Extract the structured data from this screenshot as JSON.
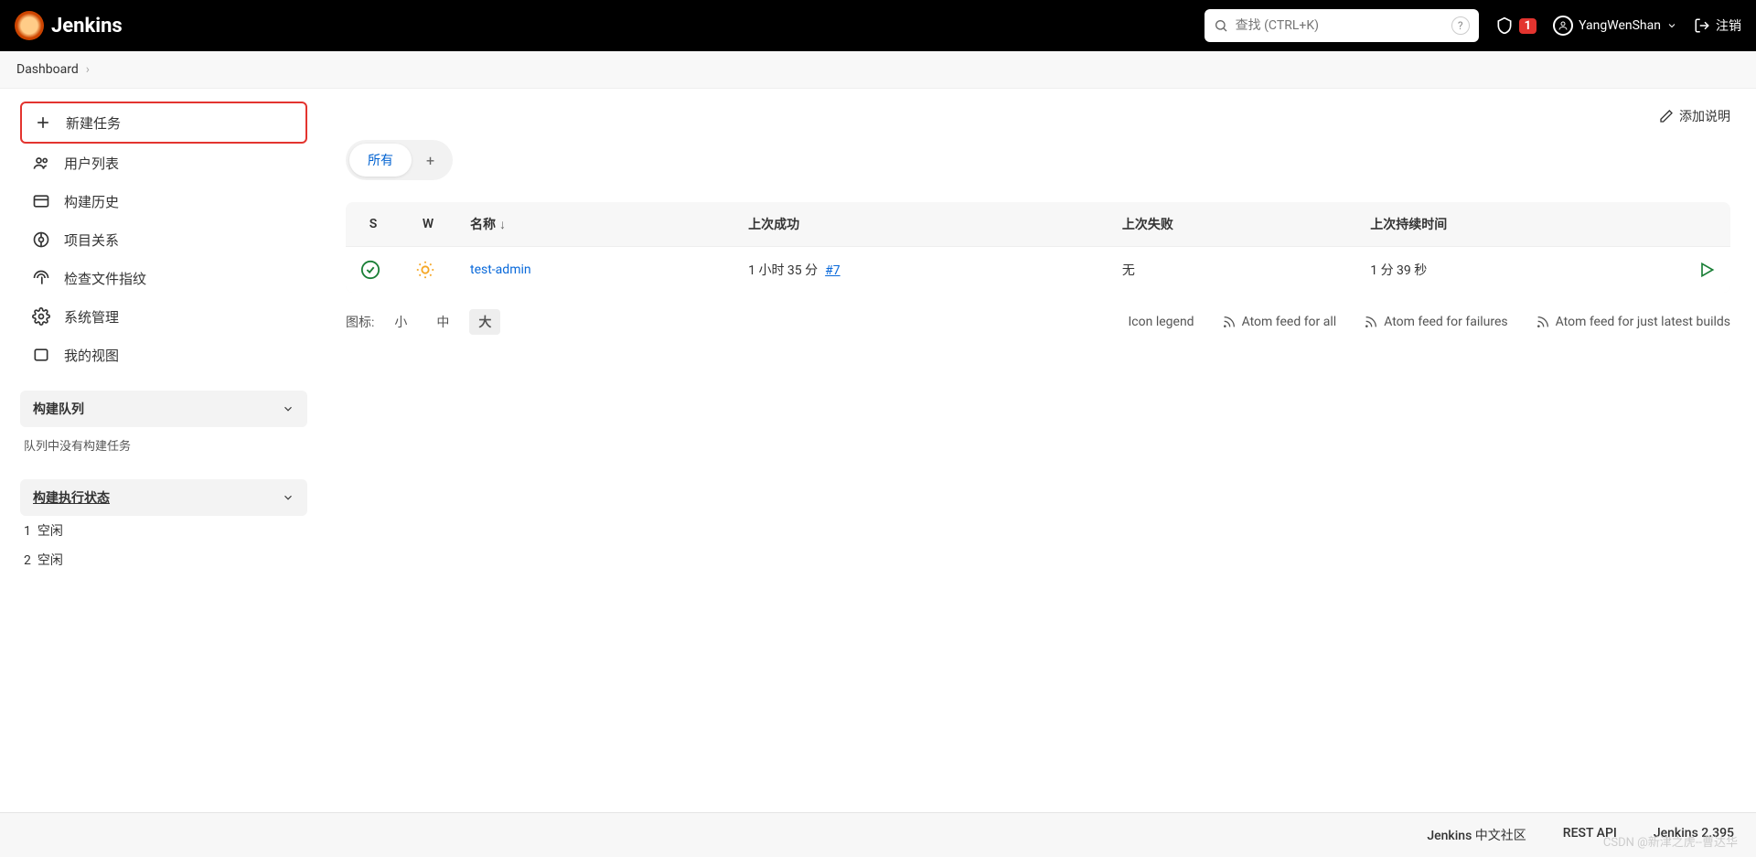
{
  "header": {
    "brand": "Jenkins",
    "search_placeholder": "查找 (CTRL+K)",
    "alert_count": "1",
    "username": "YangWenShan",
    "logout": "注销"
  },
  "breadcrumb": {
    "item": "Dashboard"
  },
  "sidebar": {
    "items": [
      {
        "label": "新建任务"
      },
      {
        "label": "用户列表"
      },
      {
        "label": "构建历史"
      },
      {
        "label": "项目关系"
      },
      {
        "label": "检查文件指纹"
      },
      {
        "label": "系统管理"
      },
      {
        "label": "我的视图"
      }
    ],
    "queue": {
      "title": "构建队列",
      "empty": "队列中没有构建任务"
    },
    "executor": {
      "title": "构建执行状态",
      "rows": [
        {
          "num": "1",
          "state": "空闲"
        },
        {
          "num": "2",
          "state": "空闲"
        }
      ]
    }
  },
  "main": {
    "add_description": "添加说明",
    "tabs": {
      "all": "所有"
    },
    "columns": {
      "s": "S",
      "w": "W",
      "name": "名称",
      "last_success": "上次成功",
      "last_failure": "上次失败",
      "last_duration": "上次持续时间"
    },
    "sort_indicator": "↓",
    "rows": [
      {
        "name": "test-admin",
        "last_success_time": "1 小时 35 分",
        "last_success_build": "#7",
        "last_failure": "无",
        "last_duration": "1 分 39 秒"
      }
    ],
    "icon_label": "图标:",
    "sizes": {
      "s": "小",
      "m": "中",
      "l": "大"
    },
    "legend": "Icon legend",
    "feeds": {
      "all": "Atom feed for all",
      "failures": "Atom feed for failures",
      "latest": "Atom feed for just latest builds"
    }
  },
  "footer": {
    "community": "Jenkins 中文社区",
    "rest": "REST API",
    "version": "Jenkins 2.395"
  },
  "watermark": "CSDN @新津之虎--曹达华"
}
